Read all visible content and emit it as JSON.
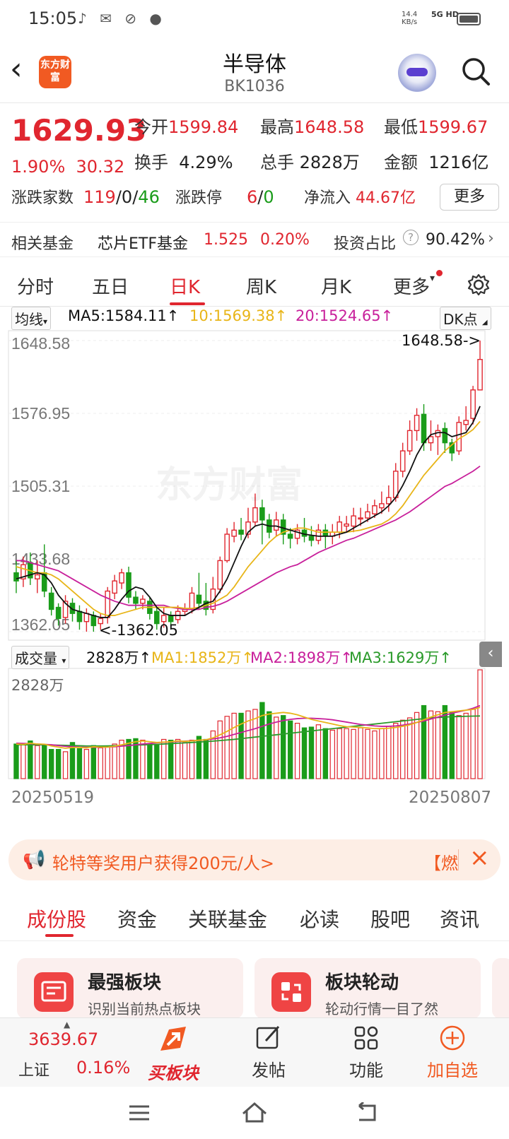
{
  "status_bar": {
    "time": "15:05",
    "net_speed": "14.4",
    "net_unit": "KB/s",
    "signal": "5G HD"
  },
  "header": {
    "back_icon": "chevron-left-icon",
    "logo_text": "东方财富",
    "title": "半导体",
    "code": "BK1036"
  },
  "quote": {
    "price": "1629.93",
    "change_pct": "1.90%",
    "change_abs": "30.32",
    "open_label": "今开",
    "open": "1599.84",
    "high_label": "最高",
    "high": "1648.58",
    "low_label": "最低",
    "low": "1599.67",
    "turnover_label": "换手",
    "turnover": "4.29%",
    "volume_label": "总手",
    "volume": "2828万",
    "amount_label": "金额",
    "amount": "1216亿",
    "updown_label": "涨跌家数",
    "up": "119",
    "flat": "0",
    "down": "46",
    "limit_label": "涨跌停",
    "limit_up": "6",
    "limit_down": "0",
    "inflow_label": "净流入",
    "inflow": "44.67亿",
    "more_label": "更多"
  },
  "fund": {
    "label": "相关基金",
    "name": "芯片ETF基金",
    "price": "1.525",
    "pct": "0.20%",
    "ratio_label": "投资占比",
    "ratio": "90.42%"
  },
  "tabs": [
    "分时",
    "五日",
    "日K",
    "周K",
    "月K",
    "更多"
  ],
  "chart": {
    "ma_select": "均线",
    "ma5": "MA5:1584.11↑",
    "ma10": "10:1569.38↑",
    "ma20": "20:1524.65↑",
    "dk_label": "DK点",
    "y_labels": [
      "1648.58",
      "1576.95",
      "1505.31",
      "1433.68",
      "1362.05"
    ],
    "high_marker": "1648.58->",
    "low_marker": "<-1362.05",
    "watermark": "东方财富",
    "vol_select": "成交量",
    "vol_value": "2828万↑",
    "vol_ma1": "MA1:1852万↑",
    "vol_ma2": "MA2:1898万↑",
    "vol_ma3": "MA3:1629万↑",
    "vol_max": "2828万",
    "date_start": "20250519",
    "date_end": "20250807"
  },
  "chart_data": {
    "type": "candlestick",
    "y_range": [
      1362.05,
      1648.58
    ],
    "candles": [
      [
        1420,
        1412,
        1432,
        1400
      ],
      [
        1414,
        1428,
        1436,
        1406
      ],
      [
        1430,
        1415,
        1440,
        1408
      ],
      [
        1414,
        1418,
        1432,
        1400
      ],
      [
        1420,
        1402,
        1448,
        1396
      ],
      [
        1400,
        1384,
        1406,
        1378
      ],
      [
        1386,
        1375,
        1390,
        1368
      ],
      [
        1376,
        1392,
        1398,
        1370
      ],
      [
        1390,
        1380,
        1395,
        1372
      ],
      [
        1382,
        1372,
        1388,
        1364
      ],
      [
        1372,
        1380,
        1385,
        1362
      ],
      [
        1378,
        1368,
        1382,
        1362
      ],
      [
        1370,
        1375,
        1380,
        1364
      ],
      [
        1376,
        1402,
        1406,
        1370
      ],
      [
        1400,
        1412,
        1418,
        1394
      ],
      [
        1410,
        1420,
        1424,
        1404
      ],
      [
        1420,
        1396,
        1426,
        1390
      ],
      [
        1396,
        1390,
        1402,
        1384
      ],
      [
        1390,
        1394,
        1398,
        1384
      ],
      [
        1392,
        1380,
        1396,
        1374
      ],
      [
        1382,
        1370,
        1386,
        1364
      ],
      [
        1372,
        1378,
        1386,
        1366
      ],
      [
        1378,
        1372,
        1382,
        1366
      ],
      [
        1374,
        1382,
        1388,
        1370
      ],
      [
        1382,
        1384,
        1390,
        1378
      ],
      [
        1384,
        1400,
        1406,
        1380
      ],
      [
        1398,
        1390,
        1420,
        1384
      ],
      [
        1392,
        1384,
        1410,
        1378
      ],
      [
        1384,
        1404,
        1416,
        1380
      ],
      [
        1404,
        1432,
        1436,
        1400
      ],
      [
        1432,
        1458,
        1464,
        1430
      ],
      [
        1456,
        1462,
        1470,
        1450
      ],
      [
        1462,
        1458,
        1474,
        1452
      ],
      [
        1458,
        1470,
        1484,
        1454
      ],
      [
        1470,
        1484,
        1498,
        1466
      ],
      [
        1484,
        1472,
        1492,
        1448
      ],
      [
        1472,
        1460,
        1478,
        1454
      ],
      [
        1462,
        1472,
        1480,
        1456
      ],
      [
        1472,
        1458,
        1478,
        1448
      ],
      [
        1458,
        1454,
        1464,
        1444
      ],
      [
        1454,
        1462,
        1468,
        1448
      ],
      [
        1462,
        1456,
        1474,
        1450
      ],
      [
        1456,
        1452,
        1466,
        1446
      ],
      [
        1452,
        1462,
        1468,
        1448
      ],
      [
        1462,
        1456,
        1468,
        1444
      ],
      [
        1456,
        1460,
        1468,
        1448
      ],
      [
        1460,
        1470,
        1476,
        1454
      ],
      [
        1466,
        1468,
        1476,
        1460
      ],
      [
        1466,
        1476,
        1484,
        1460
      ],
      [
        1474,
        1474,
        1484,
        1466
      ],
      [
        1474,
        1480,
        1488,
        1470
      ],
      [
        1478,
        1486,
        1492,
        1474
      ],
      [
        1484,
        1488,
        1500,
        1478
      ],
      [
        1488,
        1494,
        1506,
        1480
      ],
      [
        1494,
        1520,
        1528,
        1490
      ],
      [
        1520,
        1540,
        1548,
        1514
      ],
      [
        1540,
        1560,
        1570,
        1536
      ],
      [
        1560,
        1575,
        1582,
        1550
      ],
      [
        1576,
        1548,
        1586,
        1540
      ],
      [
        1548,
        1554,
        1570,
        1540
      ],
      [
        1554,
        1560,
        1566,
        1536
      ],
      [
        1562,
        1548,
        1568,
        1538
      ],
      [
        1548,
        1538,
        1552,
        1530
      ],
      [
        1540,
        1568,
        1574,
        1536
      ],
      [
        1566,
        1570,
        1584,
        1560
      ],
      [
        1572,
        1600,
        1604,
        1566
      ],
      [
        1600,
        1630,
        1648.58,
        1599.67
      ]
    ],
    "ma5": [
      1414,
      1416,
      1418,
      1420,
      1418,
      1410,
      1398,
      1390,
      1384,
      1382,
      1380,
      1378,
      1376,
      1376,
      1384,
      1394,
      1402,
      1406,
      1404,
      1396,
      1386,
      1380,
      1378,
      1378,
      1378,
      1382,
      1386,
      1390,
      1392,
      1402,
      1414,
      1430,
      1446,
      1460,
      1466,
      1468,
      1466,
      1466,
      1464,
      1462,
      1460,
      1458,
      1457,
      1456,
      1456,
      1456,
      1458,
      1460,
      1464,
      1468,
      1472,
      1476,
      1480,
      1486,
      1494,
      1506,
      1520,
      1536,
      1548,
      1556,
      1558,
      1558,
      1554,
      1556,
      1558,
      1568,
      1584
    ],
    "ma10": [
      1426,
      1424,
      1422,
      1420,
      1420,
      1418,
      1414,
      1408,
      1402,
      1396,
      1390,
      1384,
      1380,
      1378,
      1378,
      1380,
      1382,
      1384,
      1386,
      1386,
      1386,
      1386,
      1386,
      1386,
      1385,
      1385,
      1386,
      1388,
      1390,
      1394,
      1398,
      1406,
      1416,
      1426,
      1434,
      1442,
      1450,
      1456,
      1460,
      1462,
      1464,
      1464,
      1462,
      1460,
      1460,
      1460,
      1460,
      1460,
      1461,
      1462,
      1464,
      1466,
      1468,
      1472,
      1478,
      1486,
      1496,
      1506,
      1516,
      1524,
      1532,
      1540,
      1546,
      1552,
      1556,
      1561,
      1569
    ],
    "ma20": [
      1432,
      1432,
      1430,
      1428,
      1426,
      1424,
      1422,
      1418,
      1414,
      1410,
      1406,
      1402,
      1398,
      1395,
      1392,
      1390,
      1388,
      1388,
      1388,
      1388,
      1388,
      1388,
      1386,
      1385,
      1384,
      1384,
      1384,
      1386,
      1387,
      1389,
      1392,
      1396,
      1400,
      1404,
      1408,
      1412,
      1416,
      1420,
      1423,
      1426,
      1428,
      1432,
      1436,
      1440,
      1443,
      1446,
      1449,
      1452,
      1454,
      1457,
      1460,
      1463,
      1466,
      1469,
      1472,
      1476,
      1480,
      1485,
      1490,
      1495,
      1500,
      1505,
      1508,
      1512,
      1516,
      1520,
      1525
    ],
    "volume": [
      900,
      880,
      980,
      860,
      880,
      760,
      760,
      700,
      940,
      780,
      760,
      860,
      800,
      820,
      900,
      1000,
      1020,
      1040,
      1000,
      900,
      880,
      1020,
      1000,
      1020,
      940,
      1000,
      1100,
      1020,
      1240,
      1500,
      1620,
      1700,
      1700,
      1760,
      1800,
      1980,
      1740,
      1600,
      1640,
      1500,
      1440,
      1320,
      1340,
      1400,
      1300,
      1260,
      1300,
      1300,
      1280,
      1320,
      1280,
      1240,
      1300,
      1360,
      1440,
      1520,
      1580,
      1720,
      1900,
      1760,
      1740,
      1900,
      1720,
      1640,
      1700,
      1800,
      2828
    ],
    "vol_ma1": [
      900,
      890,
      920,
      900,
      895,
      850,
      820,
      790,
      810,
      810,
      800,
      830,
      820,
      820,
      840,
      880,
      920,
      960,
      980,
      960,
      940,
      950,
      960,
      980,
      970,
      980,
      1000,
      1010,
      1060,
      1140,
      1230,
      1330,
      1420,
      1500,
      1560,
      1640,
      1680,
      1700,
      1720,
      1700,
      1660,
      1600,
      1540,
      1500,
      1460,
      1420,
      1380,
      1350,
      1340,
      1330,
      1320,
      1300,
      1300,
      1310,
      1330,
      1360,
      1400,
      1460,
      1530,
      1600,
      1660,
      1720,
      1740,
      1760,
      1780,
      1800,
      1852
    ],
    "vol_ma2": [
      920,
      915,
      910,
      900,
      890,
      880,
      860,
      840,
      830,
      820,
      815,
      815,
      815,
      820,
      830,
      845,
      860,
      880,
      900,
      915,
      930,
      945,
      955,
      965,
      975,
      985,
      995,
      1010,
      1030,
      1060,
      1100,
      1150,
      1200,
      1250,
      1300,
      1360,
      1420,
      1470,
      1510,
      1540,
      1560,
      1570,
      1570,
      1560,
      1550,
      1530,
      1500,
      1470,
      1440,
      1410,
      1390,
      1370,
      1360,
      1360,
      1370,
      1390,
      1420,
      1460,
      1500,
      1550,
      1600,
      1650,
      1700,
      1740,
      1780,
      1830,
      1898
    ],
    "vol_ma3": [
      880,
      880,
      880,
      880,
      880,
      875,
      870,
      865,
      860,
      855,
      850,
      850,
      850,
      852,
      855,
      860,
      866,
      872,
      878,
      884,
      890,
      900,
      910,
      920,
      930,
      940,
      950,
      962,
      975,
      990,
      1005,
      1020,
      1040,
      1060,
      1080,
      1100,
      1120,
      1140,
      1160,
      1180,
      1200,
      1220,
      1240,
      1260,
      1280,
      1300,
      1320,
      1340,
      1360,
      1380,
      1400,
      1420,
      1440,
      1460,
      1480,
      1500,
      1520,
      1540,
      1560,
      1580,
      1590,
      1600,
      1610,
      1615,
      1620,
      1625,
      1629
    ]
  },
  "banner": {
    "text": "轮特等奖用户获得200元/人>",
    "tag": "【燃"
  },
  "bottom_tabs": [
    "成份股",
    "资金",
    "关联基金",
    "必读",
    "股吧",
    "资讯"
  ],
  "cards": [
    {
      "title": "最强板块",
      "desc": "识别当前热点板块"
    },
    {
      "title": "板块轮动",
      "desc": "轮动行情一目了然"
    }
  ],
  "bottom_nav": {
    "index_value": "3639.67",
    "index_name": "上证",
    "index_pct": "0.16%",
    "buy": "买板块",
    "post": "发帖",
    "func": "功能",
    "add": "加自选"
  },
  "colors": {
    "up": "#e0262f",
    "down": "#1a9c1a",
    "accent": "#f15a22",
    "ma5": "#111111",
    "ma10": "#e8b518",
    "ma20": "#c8209b"
  }
}
